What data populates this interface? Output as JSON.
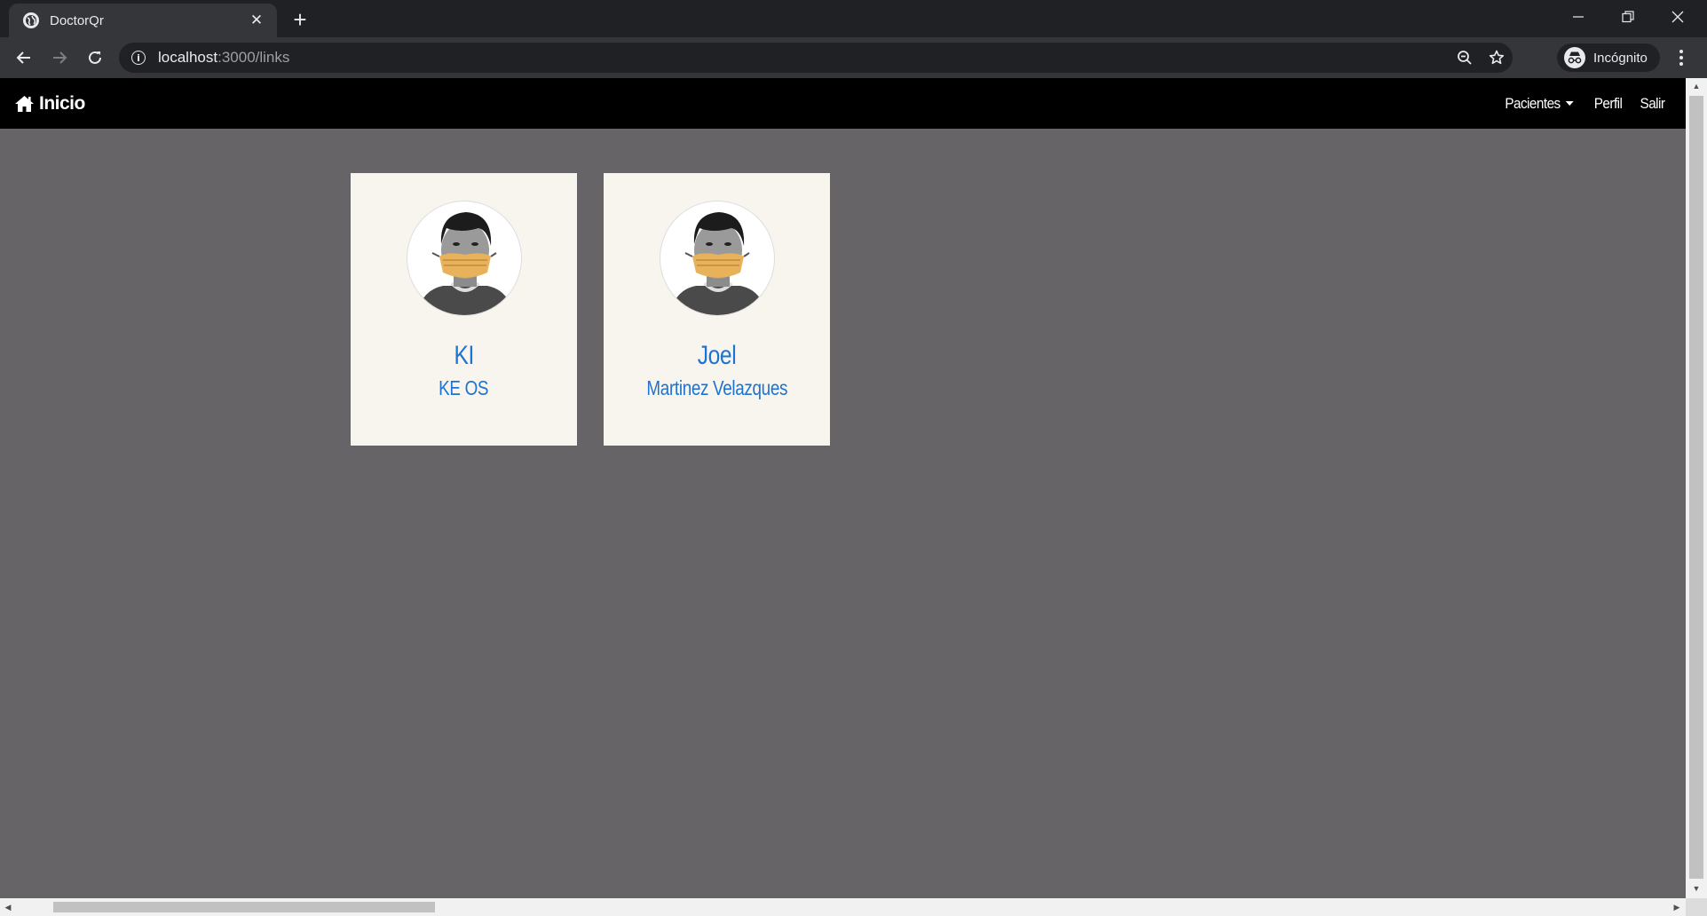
{
  "browser": {
    "tab": {
      "title": "DoctorQr"
    },
    "url": {
      "host": "localhost",
      "path": ":3000/links"
    },
    "profile": {
      "label": "Incógnito"
    }
  },
  "navbar": {
    "brand": "Inicio",
    "links": [
      {
        "label": "Pacientes"
      },
      {
        "label": "Perfil"
      },
      {
        "label": "Salir"
      }
    ]
  },
  "patients": [
    {
      "first_name": "KI",
      "last_name": "KE OS"
    },
    {
      "first_name": "Joel",
      "last_name": "Martinez Velazques"
    }
  ],
  "colors": {
    "page_background": "#666467",
    "navbar_background": "#000000",
    "card_background": "#f7f5ee",
    "name_color": "#1e73d2"
  }
}
